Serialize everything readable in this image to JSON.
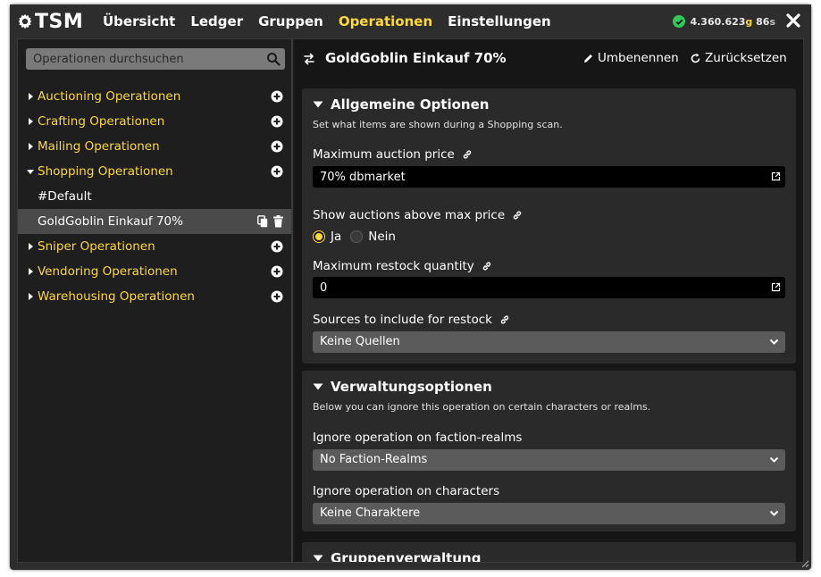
{
  "app": {
    "logo_text": "TSM",
    "nav": [
      {
        "label": "Übersicht",
        "active": false
      },
      {
        "label": "Ledger",
        "active": false
      },
      {
        "label": "Gruppen",
        "active": false
      },
      {
        "label": "Operationen",
        "active": true
      },
      {
        "label": "Einstellungen",
        "active": false
      }
    ],
    "gold": {
      "amount": "4.360.623",
      "gold_suffix": "g",
      "silver": "86",
      "silver_suffix": "s"
    }
  },
  "sidebar": {
    "search_placeholder": "Operationen durchsuchen",
    "items": [
      {
        "label": "Auctioning Operationen",
        "expanded": false
      },
      {
        "label": "Crafting Operationen",
        "expanded": false
      },
      {
        "label": "Mailing Operationen",
        "expanded": false
      },
      {
        "label": "Shopping Operationen",
        "expanded": true
      },
      {
        "label": "#Default",
        "child": true
      },
      {
        "label": "GoldGoblin Einkauf 70%",
        "child": true,
        "selected": true
      },
      {
        "label": "Sniper Operationen",
        "expanded": false
      },
      {
        "label": "Vendoring Operationen",
        "expanded": false
      },
      {
        "label": "Warehousing Operationen",
        "expanded": false
      }
    ]
  },
  "main": {
    "title": "GoldGoblin Einkauf 70%",
    "rename_label": "Umbenennen",
    "reset_label": "Zurücksetzen",
    "general": {
      "title": "Allgemeine Optionen",
      "description": "Set what items are shown during a Shopping scan.",
      "max_price_label": "Maximum auction price",
      "max_price_value": "70% dbmarket",
      "show_above_label": "Show auctions above max price",
      "yes_label": "Ja",
      "no_label": "Nein",
      "show_above_selected": "Ja",
      "restock_label": "Maximum restock quantity",
      "restock_value": "0",
      "sources_label": "Sources to include for restock",
      "sources_value": "Keine Quellen"
    },
    "management": {
      "title": "Verwaltungsoptionen",
      "description": "Below you can ignore this operation on certain characters or realms.",
      "faction_label": "Ignore operation on faction-realms",
      "faction_value": "No Faction-Realms",
      "chars_label": "Ignore operation on characters",
      "chars_value": "Keine Charaktere"
    },
    "groups": {
      "title": "Gruppenverwaltung"
    }
  },
  "colors": {
    "accent": "#ffd839",
    "panel": "#2a2a2a",
    "background": "#161616"
  }
}
